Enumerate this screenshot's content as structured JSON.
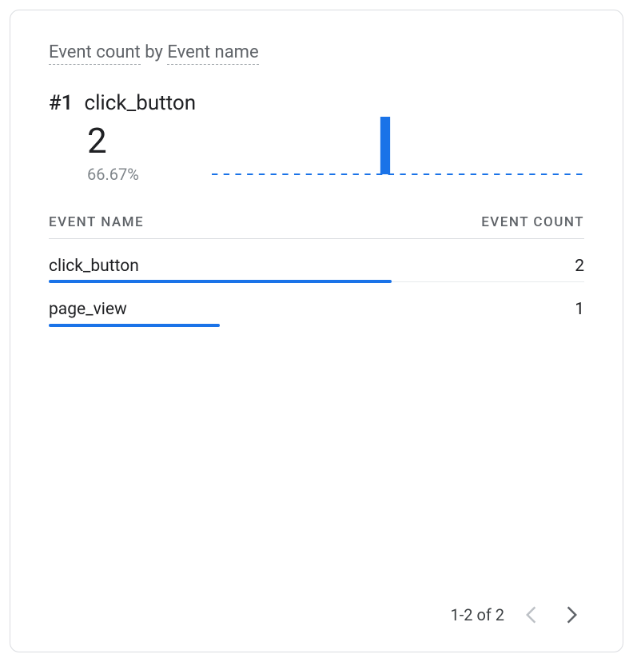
{
  "header": {
    "metric_label": "Event count",
    "by_label": "by",
    "dimension_label": "Event name"
  },
  "top_event": {
    "rank_label": "#1",
    "name": "click_button",
    "value": "2",
    "percent": "66.67%"
  },
  "table": {
    "col_dimension": "EVENT NAME",
    "col_metric": "EVENT COUNT",
    "rows": [
      {
        "name": "click_button",
        "value": "2"
      },
      {
        "name": "page_view",
        "value": "1"
      }
    ]
  },
  "pagination": {
    "range_label": "1-2 of 2"
  },
  "colors": {
    "accent": "#1a73e8"
  },
  "chart_data": {
    "type": "bar",
    "title": "Event count by Event name",
    "xlabel": "Event name",
    "ylabel": "Event count",
    "categories": [
      "click_button",
      "page_view"
    ],
    "values": [
      2,
      1
    ],
    "ylim": [
      0,
      2
    ]
  }
}
